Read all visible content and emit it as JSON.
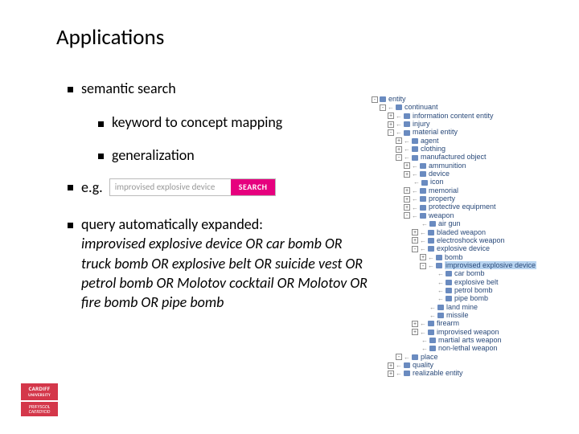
{
  "title": "Applications",
  "bullets": {
    "semantic_search": "semantic search",
    "keyword_mapping": "keyword to concept mapping",
    "generalization": "generalization",
    "eg": "e.g.",
    "query_head": "query automatically expanded:"
  },
  "search": {
    "placeholder": "improvised explosive device",
    "button": "SEARCH"
  },
  "query_expansion": "improvised explosive device OR car bomb OR truck bomb OR explosive belt OR suicide vest OR petrol bomb OR Molotov cocktail OR Molotov OR fire bomb OR pipe bomb",
  "logo": {
    "top": "CARDIFF",
    "uni": "UNIVERSITY",
    "bot1": "PRIFYSGOL",
    "bot2": "CAERDYDD"
  },
  "tree": [
    {
      "d": 0,
      "t": "-",
      "a": 0,
      "l": "entity"
    },
    {
      "d": 1,
      "t": "-",
      "a": 1,
      "l": "continuant"
    },
    {
      "d": 2,
      "t": "+",
      "a": 1,
      "l": "information content entity"
    },
    {
      "d": 2,
      "t": "+",
      "a": 1,
      "l": "injury"
    },
    {
      "d": 2,
      "t": "-",
      "a": 1,
      "l": "material entity"
    },
    {
      "d": 3,
      "t": "+",
      "a": 1,
      "l": "agent"
    },
    {
      "d": 3,
      "t": "+",
      "a": 1,
      "l": "clothing"
    },
    {
      "d": 3,
      "t": "-",
      "a": 1,
      "l": "manufactured object"
    },
    {
      "d": 4,
      "t": "+",
      "a": 1,
      "l": "ammunition"
    },
    {
      "d": 4,
      "t": "+",
      "a": 1,
      "l": "device"
    },
    {
      "d": 4,
      "t": "",
      "a": 1,
      "l": "icon"
    },
    {
      "d": 4,
      "t": "+",
      "a": 1,
      "l": "memorial"
    },
    {
      "d": 4,
      "t": "+",
      "a": 1,
      "l": "property"
    },
    {
      "d": 4,
      "t": "+",
      "a": 1,
      "l": "protective equipment"
    },
    {
      "d": 4,
      "t": "-",
      "a": 1,
      "l": "weapon"
    },
    {
      "d": 5,
      "t": "",
      "a": 1,
      "l": "air gun"
    },
    {
      "d": 5,
      "t": "+",
      "a": 1,
      "l": "bladed weapon"
    },
    {
      "d": 5,
      "t": "+",
      "a": 1,
      "l": "electroshock weapon"
    },
    {
      "d": 5,
      "t": "-",
      "a": 1,
      "l": "explosive device"
    },
    {
      "d": 6,
      "t": "+",
      "a": 1,
      "l": "bomb"
    },
    {
      "d": 6,
      "t": "-",
      "a": 1,
      "l": "improvised explosive device",
      "hl": true
    },
    {
      "d": 7,
      "t": "",
      "a": 1,
      "l": "car bomb"
    },
    {
      "d": 7,
      "t": "",
      "a": 1,
      "l": "explosive belt"
    },
    {
      "d": 7,
      "t": "",
      "a": 1,
      "l": "petrol bomb"
    },
    {
      "d": 7,
      "t": "",
      "a": 1,
      "l": "pipe bomb"
    },
    {
      "d": 6,
      "t": "",
      "a": 1,
      "l": "land mine"
    },
    {
      "d": 6,
      "t": "",
      "a": 1,
      "l": "missile"
    },
    {
      "d": 5,
      "t": "+",
      "a": 1,
      "l": "firearm"
    },
    {
      "d": 5,
      "t": "+",
      "a": 1,
      "l": "improvised weapon"
    },
    {
      "d": 5,
      "t": "",
      "a": 1,
      "l": "martial arts weapon"
    },
    {
      "d": 5,
      "t": "",
      "a": 1,
      "l": "non-lethal weapon"
    },
    {
      "d": 3,
      "t": "-",
      "a": 1,
      "l": "place"
    },
    {
      "d": 2,
      "t": "+",
      "a": 1,
      "l": "quality"
    },
    {
      "d": 2,
      "t": "+",
      "a": 1,
      "l": "realizable entity"
    }
  ]
}
